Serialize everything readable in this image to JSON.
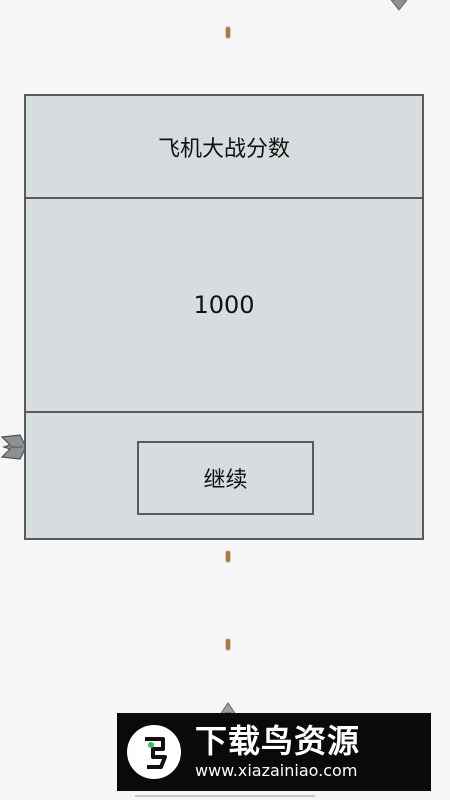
{
  "dialog": {
    "title": "飞机大战分数",
    "score": "1000",
    "continue_label": "继续"
  },
  "watermark": {
    "name": "下载鸟资源",
    "url": "www.xiazainiao.com",
    "logo_glyph": "鸟"
  },
  "colors": {
    "dialog_bg": "#d7dcdf",
    "dialog_border": "#5a5a5a",
    "bullet": "#b0773a",
    "background": "#f6f6f6"
  },
  "icons": {
    "enemy": "enemy-plane-icon",
    "bullet": "bullet-icon",
    "logo": "bird-logo-icon"
  }
}
